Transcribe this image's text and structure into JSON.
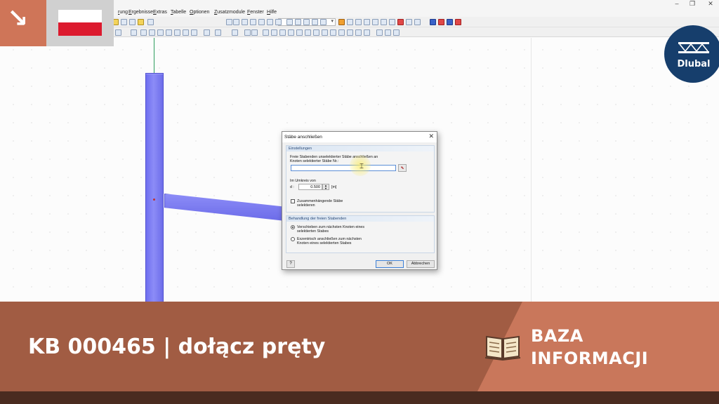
{
  "menu": {
    "items": [
      "rung",
      "Ergebnisse",
      "Extras",
      "Tabelle",
      "Optionen",
      "Zusatzmodule",
      "Fenster",
      "Hilfe"
    ]
  },
  "window_controls": {
    "minimize": "–",
    "restore": "❐",
    "close": "✕"
  },
  "dialog": {
    "title": "Stäbe anschließen",
    "close": "✕",
    "group1": {
      "header": "Einstellungen",
      "prompt_line1": "Freie Stabenden unselektierter Stäbe anschließen an",
      "prompt_line2": "Knoten selektierter Stäbe Nr.:",
      "members_value": "",
      "radius_label": "Im Umkreis von",
      "d_label": "d :",
      "d_value": "0.500",
      "unit": "[m]",
      "checkbox_line1": "Zusammenhängende Stäbe",
      "checkbox_line2": "selektieren",
      "checkbox_checked": false
    },
    "group2": {
      "header": "Behandlung der freien Stabenden",
      "option1_line1": "Verschieben zum nächsten Knoten eines",
      "option1_line2": "selektierten Stabes",
      "option2_line1": "Exzentrisch anschließen zum nächsten",
      "option2_line2": "Knoten eines selektierten Stabes",
      "selected_option": 1
    },
    "ok": "OK",
    "cancel": "Abbrechen"
  },
  "logo": {
    "text": "Dlubal"
  },
  "banner": {
    "title": "KB 000465 | dołącz pręty",
    "kb_line1": "BAZA",
    "kb_line2": "INFORMACJI"
  },
  "colors": {
    "banner": "#a15c43",
    "banner_accent": "#c9775b",
    "member": "#7a7af2",
    "logo": "#163e6c",
    "flag_red": "#dc1a2e"
  },
  "icons": [
    "arrow-down-right-icon",
    "poland-flag-icon",
    "dlubal-logo-icon",
    "book-icon",
    "help-icon",
    "pick-member-icon"
  ]
}
